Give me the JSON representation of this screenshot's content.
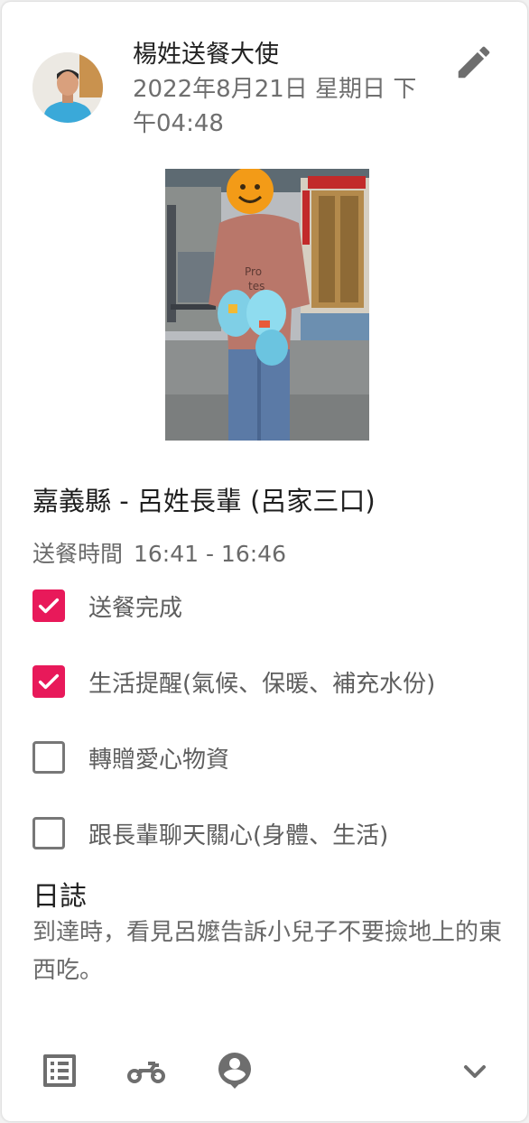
{
  "post": {
    "author": "楊姓送餐大使",
    "datetime": "2022年8月21日 星期日 下午04:48",
    "recipient": "嘉義縣 - 呂姓長輩 (呂家三口)",
    "delivery_time_label": "送餐時間",
    "delivery_time_range": "16:41 - 16:46"
  },
  "tasks": [
    {
      "label": "送餐完成",
      "checked": true
    },
    {
      "label": "生活提醒(氣候、保暖、補充水份)",
      "checked": true
    },
    {
      "label": "轉贈愛心物資",
      "checked": false
    },
    {
      "label": "跟長輩聊天關心(身體、生活)",
      "checked": false
    }
  ],
  "log": {
    "title": "日誌",
    "body": "到達時，看見呂嬤告訴小兒子不要撿地上的東西吃。"
  },
  "icons": {
    "edit": "pencil-icon",
    "list": "list-icon",
    "vehicle": "motorcycle-icon",
    "location": "person-pin-icon",
    "expand": "chevron-down-icon"
  },
  "colors": {
    "checkbox_checked": "#e8195a",
    "icon_gray": "#6e6e6e"
  }
}
